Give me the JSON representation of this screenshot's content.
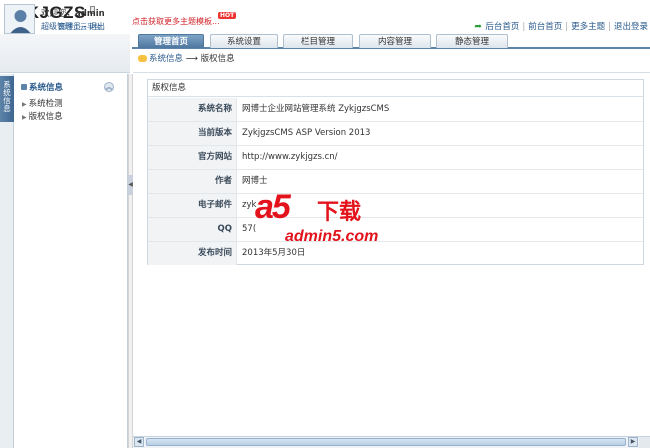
{
  "header": {
    "logo": "ZYKJGZS",
    "logo_sub": "网博士云平台",
    "promo": "点击获取更多主题模板...",
    "hot_badge": "HOT",
    "links": [
      "后台首页",
      "前台首页",
      "更多主题",
      "退出登录"
    ]
  },
  "tabs": [
    {
      "label": "管理首页",
      "active": true
    },
    {
      "label": "系统设置",
      "active": false
    },
    {
      "label": "栏目管理",
      "active": false
    },
    {
      "label": "内容管理",
      "active": false
    },
    {
      "label": "静态管理",
      "active": false
    }
  ],
  "user": {
    "greeting": "欢迎您，",
    "name": "admin",
    "role": "超级管理员",
    "logout": "退出"
  },
  "sidebar": {
    "vertical_tab": "系统信息",
    "section_title": "系统信息",
    "items": [
      "系统检测",
      "版权信息"
    ]
  },
  "breadcrumb": {
    "first": "系统信息",
    "arrow": "⟶",
    "second": "版权信息"
  },
  "panel": {
    "title": "版权信息",
    "rows": [
      {
        "label": "系统名称",
        "value": "网博士企业网站管理系统 ZykjgzsCMS"
      },
      {
        "label": "当前版本",
        "value": "ZykjgzsCMS ASP Version 2013"
      },
      {
        "label": "官方网站",
        "value": "http://www.zykjgzs.cn/"
      },
      {
        "label": "作者",
        "value": "网博士"
      },
      {
        "label": "电子邮件",
        "value": "zyk"
      },
      {
        "label": "QQ",
        "value": "57("
      },
      {
        "label": "发布时间",
        "value": "2013年5月30日"
      }
    ]
  },
  "watermark": {
    "mark": "a5",
    "text": "下载",
    "url": "admin5.com"
  },
  "colors": {
    "accent": "#4e77a0",
    "promo": "#d2232a",
    "watermark": "#e3121b"
  }
}
